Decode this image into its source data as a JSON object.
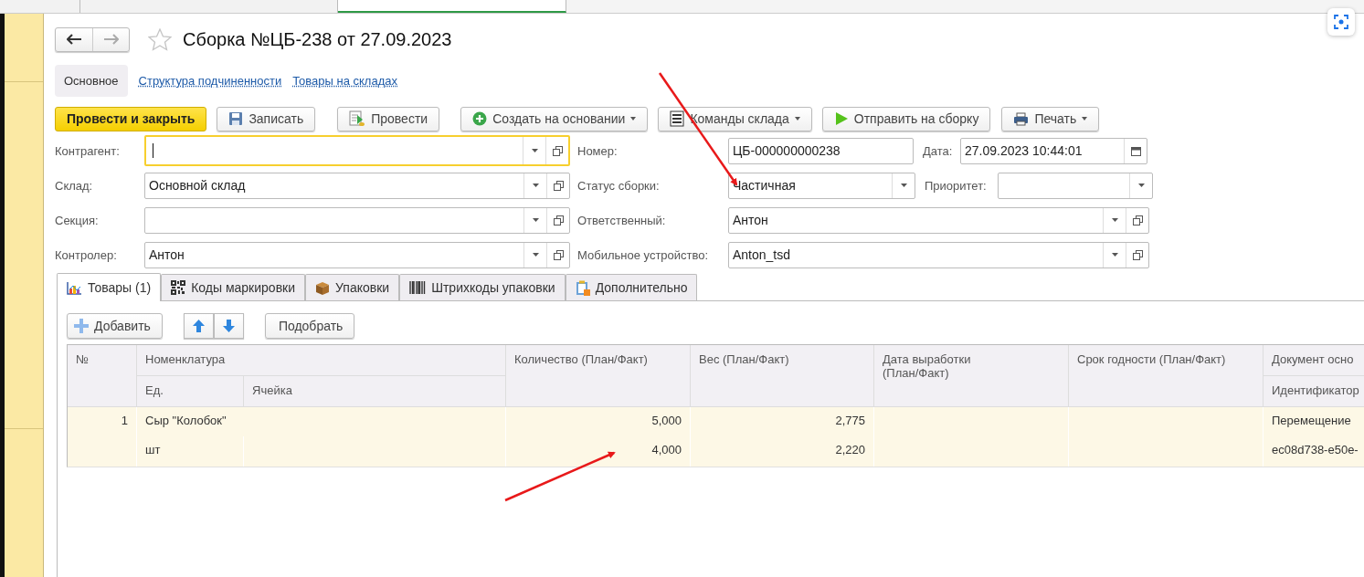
{
  "window_tabs": [
    {
      "selected": false
    },
    {
      "selected": false
    },
    {
      "selected": true
    }
  ],
  "document": {
    "title": "Сборка №ЦБ-238 от 27.09.2023",
    "favorite": false
  },
  "sections": [
    {
      "label": "Основное",
      "selected": true
    },
    {
      "label": "Структура подчиненности",
      "selected": false
    },
    {
      "label": "Товары на складах",
      "selected": false
    }
  ],
  "toolbar": [
    {
      "label": "Провести и закрыть",
      "kind": "primary",
      "dropdown": false
    },
    {
      "label": "Записать",
      "kind": "normal",
      "dropdown": false
    },
    {
      "label": "Провести",
      "kind": "normal",
      "dropdown": false
    },
    {
      "label": "Создать на основании",
      "kind": "normal",
      "dropdown": true
    },
    {
      "label": "Команды склада",
      "kind": "normal",
      "dropdown": true
    },
    {
      "label": "Отправить на сборку",
      "kind": "normal",
      "dropdown": false
    },
    {
      "label": "Печать",
      "kind": "normal",
      "dropdown": true
    }
  ],
  "form_rows": [
    {
      "fields": [
        {
          "label": "Контрагент:",
          "kind": "combo",
          "focused": true
        },
        {
          "label": "Номер:",
          "kind": "text",
          "value": "ЦБ-000000000238",
          "focused": false
        },
        {
          "label": "Дата:",
          "kind": "date",
          "value": "27.09.2023 10:44:01",
          "focused": false
        }
      ]
    },
    {
      "fields": [
        {
          "label": "Склад:",
          "kind": "combo",
          "value": "Основной склад",
          "focused": false
        },
        {
          "label": "Статус сборки:",
          "kind": "select",
          "value": "Частичная",
          "focused": false
        },
        {
          "label": "Приоритет:",
          "kind": "select",
          "focused": false
        }
      ]
    },
    {
      "fields": [
        {
          "label": "Секция:",
          "kind": "combo",
          "focused": false
        },
        {
          "label": "Ответственный:",
          "kind": "combo",
          "value": "Антон",
          "focused": false
        }
      ]
    },
    {
      "fields": [
        {
          "label": "Контролер:",
          "kind": "combo",
          "value": "Антон",
          "focused": false
        },
        {
          "label": "Мобильное устройство:",
          "kind": "combo",
          "value": "Anton_tsd",
          "focused": false
        }
      ]
    }
  ],
  "tabs": [
    {
      "label": "Товары (1)",
      "selected": true
    },
    {
      "label": "Коды маркировки",
      "selected": false
    },
    {
      "label": "Упаковки",
      "selected": false
    },
    {
      "label": "Штрихкоды упаковки",
      "selected": false
    },
    {
      "label": "Дополнительно",
      "selected": false
    }
  ],
  "table_toolbar": {
    "add": "Добавить",
    "pick": "Подобрать"
  },
  "table": {
    "header": {
      "number": "№",
      "nomenclature": "Номенклатура",
      "unit": "Ед.",
      "cell": "Ячейка",
      "quantity": "Количество (План/Факт)",
      "weight": "Вес (План/Факт)",
      "production_date": "Дата выработки (План/Факт)",
      "expiry": "Срок годности  (План/Факт)",
      "document": "Документ осно",
      "identifier": "Идентификатор"
    },
    "rows": [
      {
        "selected": true,
        "number": "1",
        "nomenclature": "Сыр \"Колобок\"",
        "unit": "шт",
        "quantity_plan": "5,000",
        "quantity_fact": "4,000",
        "weight_plan": "2,775",
        "weight_fact": "2,220",
        "document": "Перемещение",
        "identifier": "ec08d738-e50e-"
      }
    ]
  },
  "annotations": [
    {
      "kind": "arrow"
    },
    {
      "kind": "arrow"
    }
  ]
}
